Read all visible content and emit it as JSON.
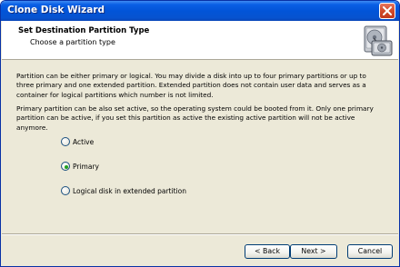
{
  "window": {
    "title": "Clone Disk Wizard"
  },
  "header": {
    "title": "Set Destination Partition Type",
    "subtitle": "Choose a partition type"
  },
  "body": {
    "paragraph1": "Partition can be either primary or logical. You may divide a disk into up to four primary partitions or up to three primary and one extended partition. Extended partition does not contain user data and serves as a container for logical partitions which number is not limited.",
    "paragraph2": "Primary partition can be also set active, so the operating system could be booted from it. Only one primary partition can be active, if you set this partition as active the existing active partition will not be active anymore."
  },
  "options": [
    {
      "label": "Active",
      "checked": false
    },
    {
      "label": "Primary",
      "checked": true
    },
    {
      "label": "Logical disk in extended partition",
      "checked": false
    }
  ],
  "buttons": {
    "back": "< Back",
    "next": "Next >",
    "cancel": "Cancel"
  },
  "icons": {
    "close": "close-icon",
    "header": "hard-disk-icon"
  }
}
